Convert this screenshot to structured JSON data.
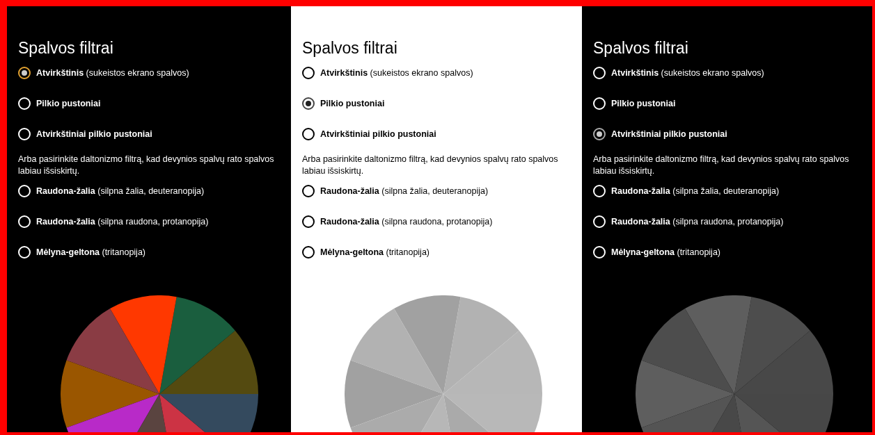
{
  "panels": [
    {
      "title": "Spalvos filtrai",
      "filters": [
        {
          "label": "**Atvirkštinis** (sukeistos ekrano spalvos)",
          "selected": true
        },
        {
          "label": "**Pilkio pustoniai**",
          "selected": false
        },
        {
          "label": "**Atvirkštiniai pilkio pustoniai**",
          "selected": false
        }
      ],
      "hint": "Arba pasirinkite daltonizmo filtrą, kad devynios spalvų rato spalvos labiau išsiskirtų.",
      "color_blind_filters": [
        {
          "label": "**Raudona-žalia** (silpna žalia, deuteranopija)",
          "selected": false
        },
        {
          "label": "**Raudona-žalia** (silpna raudona, protanopija)",
          "selected": false
        },
        {
          "label": "**Mėlyna-geltona** (tritanopija)",
          "selected": false
        }
      ]
    },
    {
      "title": "Spalvos filtrai",
      "filters": [
        {
          "label": "**Atvirkštinis** (sukeistos ekrano spalvos)",
          "selected": false
        },
        {
          "label": "**Pilkio pustoniai**",
          "selected": true
        },
        {
          "label": "**Atvirkštiniai pilkio pustoniai**",
          "selected": false
        }
      ],
      "hint": "Arba pasirinkite daltonizmo filtrą, kad devynios spalvų rato spalvos labiau išsiskirtų.",
      "color_blind_filters": [
        {
          "label": "**Raudona-žalia** (silpna žalia, deuteranopija)",
          "selected": false
        },
        {
          "label": "**Raudona-žalia** (silpna raudona, protanopija)",
          "selected": false
        },
        {
          "label": "**Mėlyna-geltona** (tritanopija)",
          "selected": false
        }
      ]
    },
    {
      "title": "Spalvos filtrai",
      "filters": [
        {
          "label": "**Atvirkštinis** (sukeistos ekrano spalvos)",
          "selected": false
        },
        {
          "label": "**Pilkio pustoniai**",
          "selected": false
        },
        {
          "label": "**Atvirkštiniai pilkio pustoniai**",
          "selected": true
        }
      ],
      "hint": "Arba pasirinkite daltonizmo filtrą, kad devynios spalvų rato spalvos labiau išsiskirtų.",
      "color_blind_filters": [
        {
          "label": "**Raudona-žalia** (silpna žalia, deuteranopija)",
          "selected": false
        },
        {
          "label": "**Raudona-žalia** (silpna raudona, protanopija)",
          "selected": false
        },
        {
          "label": "**Mėlyna-geltona** (tritanopija)",
          "selected": false
        }
      ]
    }
  ]
}
